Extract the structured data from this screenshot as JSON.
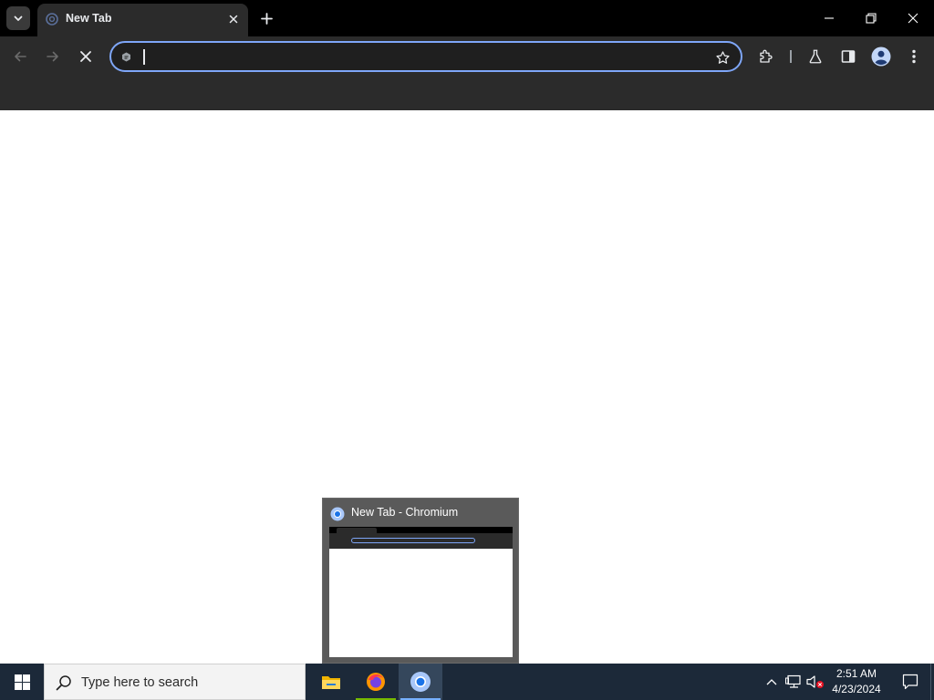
{
  "browser": {
    "tab": {
      "title": "New Tab"
    },
    "omnibox": {
      "value": "",
      "placeholder": ""
    }
  },
  "preview": {
    "title": "New Tab - Chromium"
  },
  "taskbar": {
    "search_placeholder": "Type here to search",
    "clock": {
      "time": "2:51 AM",
      "date": "4/23/2024"
    }
  },
  "colors": {
    "tabstrip": "#000000",
    "toolbar": "#2b2b2b",
    "omnibox_border": "#7ea6f8",
    "taskbar": "#1c2939",
    "preview_bg": "#5a5a5a"
  }
}
